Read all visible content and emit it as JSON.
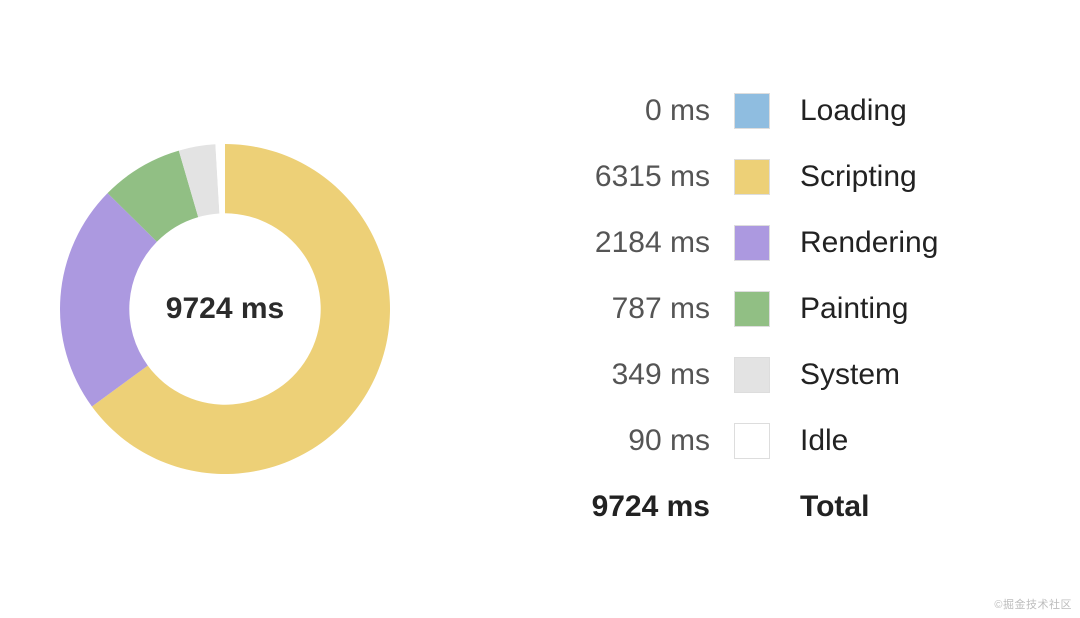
{
  "chart_data": {
    "type": "pie",
    "title": "",
    "slices": [
      {
        "name": "Loading",
        "value_ms": 0,
        "value_label": "0 ms",
        "color": "#8fbde0",
        "has_border": true
      },
      {
        "name": "Scripting",
        "value_ms": 6315,
        "value_label": "6315 ms",
        "color": "#edd077",
        "has_border": true
      },
      {
        "name": "Rendering",
        "value_ms": 2184,
        "value_label": "2184 ms",
        "color": "#ac99e0",
        "has_border": true
      },
      {
        "name": "Painting",
        "value_ms": 787,
        "value_label": "787 ms",
        "color": "#91bf84",
        "has_border": true
      },
      {
        "name": "System",
        "value_ms": 349,
        "value_label": "349 ms",
        "color": "#e3e3e3",
        "has_border": true
      },
      {
        "name": "Idle",
        "value_ms": 90,
        "value_label": "90 ms",
        "color": "#ffffff",
        "has_border": true
      }
    ],
    "total_ms": 9724,
    "total_value_label": "9724 ms",
    "total_name_label": "Total",
    "center_label": "9724 ms",
    "donut_inner_ratio": 0.58,
    "start_angle_deg": -90
  },
  "watermark": "©掘金技术社区"
}
